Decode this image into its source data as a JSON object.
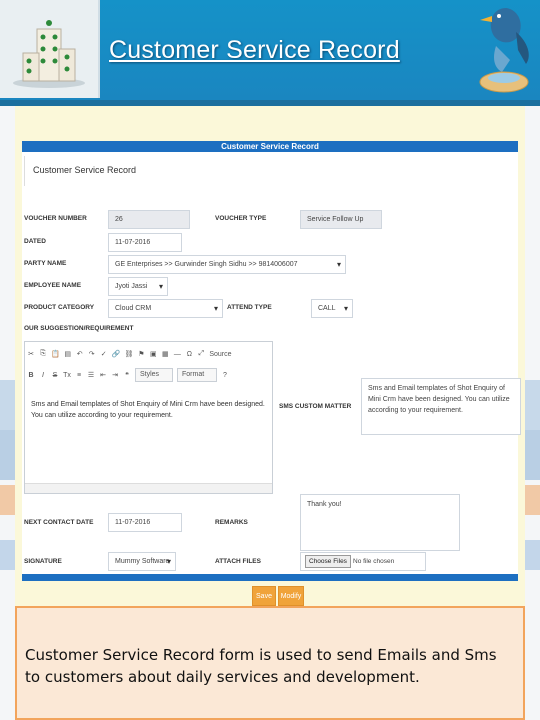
{
  "slide": {
    "title": "Customer Service Record",
    "caption": "Customer Service Record form is used to send Emails and Sms to customers about daily services and development."
  },
  "form": {
    "header": "Customer Service Record",
    "subtitle": "Customer Service Record",
    "fields": {
      "voucher_number_label": "VOUCHER NUMBER",
      "voucher_number_value": "26",
      "voucher_type_label": "VOUCHER TYPE",
      "voucher_type_value": "Service Follow Up",
      "dated_label": "DATED",
      "dated_value": "11-07-2016",
      "party_name_label": "PARTY NAME",
      "party_name_value": "GE Enterprises >> Gurwinder Singh Sidhu >> 9814006007",
      "employee_name_label": "EMPLOYEE NAME",
      "employee_name_value": "Jyoti Jassi",
      "product_category_label": "PRODUCT CATEGORY",
      "product_category_value": "Cloud CRM",
      "attend_type_label": "ATTEND TYPE",
      "attend_type_value": "CALL",
      "suggestion_label": "OUR SUGGESTION/REQUIREMENT",
      "suggestion_text": "Sms and Email templates of Shot Enquiry of Mini Crm have been designed. You can utilize according to your requirement.",
      "sms_matter_label": "SMS CUSTOM MATTER",
      "sms_matter_text": "Sms and Email templates of Shot Enquiry of Mini Crm have been designed. You can utilize according to your requirement.",
      "next_contact_label": "NEXT CONTACT DATE",
      "next_contact_value": "11-07-2016",
      "remarks_label": "REMARKS",
      "remarks_value": "Thank you!",
      "signature_label": "SIGNATURE",
      "signature_value": "Mummy Software",
      "attach_label": "ATTACH FILES",
      "choose_files": "Choose Files",
      "no_file": "No file chosen"
    },
    "toolbar": {
      "source": "Source",
      "styles": "Styles",
      "format": "Format"
    },
    "buttons": {
      "save": "Save",
      "modify": "Modify"
    }
  },
  "colors": {
    "title_band": "#1592c8",
    "form_header": "#1d6fc1",
    "button": "#f0a33a"
  }
}
